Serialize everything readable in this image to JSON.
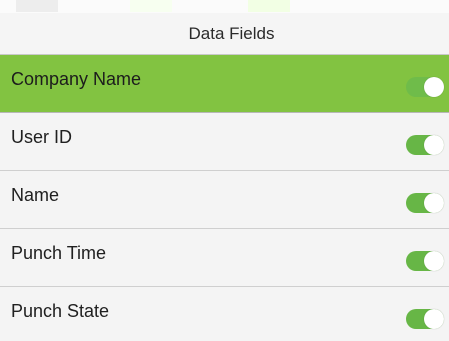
{
  "header": {
    "title": "Data Fields"
  },
  "fields": [
    {
      "label": "Company Name",
      "enabled": true,
      "selected": true
    },
    {
      "label": "User ID",
      "enabled": true,
      "selected": false
    },
    {
      "label": "Name",
      "enabled": true,
      "selected": false
    },
    {
      "label": "Punch Time",
      "enabled": true,
      "selected": false
    },
    {
      "label": "Punch State",
      "enabled": true,
      "selected": false
    }
  ],
  "colors": {
    "selected_row": "#82c341",
    "toggle_on": "#67b646",
    "background": "#f4f4f4",
    "divider": "#cfcfcf"
  },
  "icons": {
    "toggle": "toggle-switch-icon"
  }
}
